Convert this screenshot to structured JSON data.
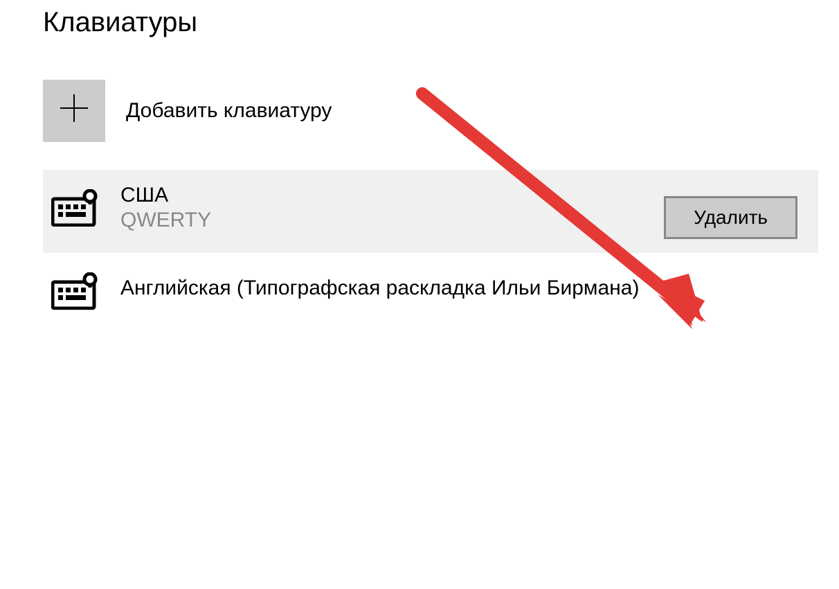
{
  "section": {
    "title": "Клавиатуры"
  },
  "addKeyboard": {
    "label": "Добавить клавиатуру"
  },
  "keyboards": [
    {
      "name": "США",
      "layout": "QWERTY"
    },
    {
      "name": "Английская (Типографская раскладка Ильи Бирмана)"
    }
  ],
  "actions": {
    "deleteLabel": "Удалить"
  }
}
